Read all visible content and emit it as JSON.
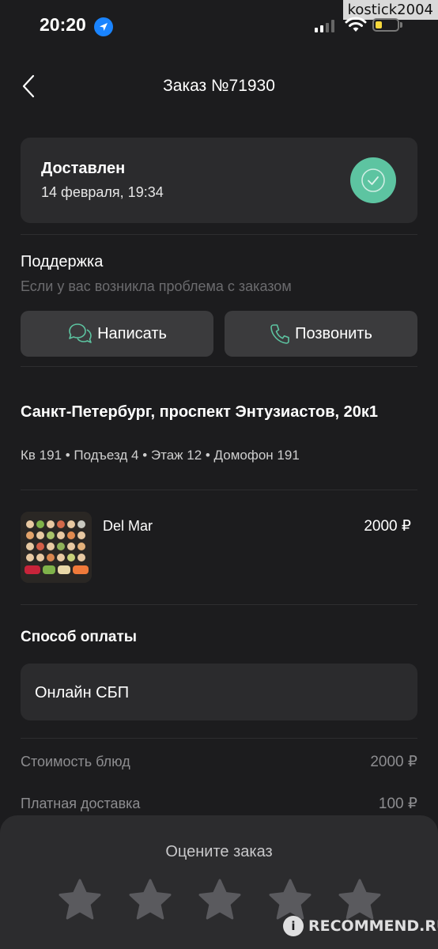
{
  "watermark_top": "kostick2004",
  "status_bar": {
    "time": "20:20"
  },
  "header": {
    "title": "Заказ №71930"
  },
  "order_status": {
    "title": "Доставлен",
    "date": "14 февраля, 19:34"
  },
  "support": {
    "title": "Поддержка",
    "subtitle": "Если у вас возникла проблема с заказом",
    "write_label": "Написать",
    "call_label": "Позвонить"
  },
  "address": {
    "line": "Санкт-Петербург, проспект Энтузиастов, 20к1",
    "details": "Кв 191 • Подъезд 4 • Этаж 12 • Домофон 191"
  },
  "items": [
    {
      "name": "Del Mar",
      "price": "2000 ₽"
    }
  ],
  "payment": {
    "title": "Способ оплаты",
    "method": "Онлайн СБП"
  },
  "summary": [
    {
      "label": "Стоимость блюд",
      "value": "2000 ₽"
    },
    {
      "label": "Платная доставка",
      "value": "100 ₽"
    }
  ],
  "rating": {
    "title": "Оцените заказ",
    "stars": 5,
    "selected": 0
  },
  "watermark_bottom": {
    "badge": "i",
    "text": "RECOMMEND.RU"
  },
  "colors": {
    "accent": "#5dc4a1",
    "background": "#1c1c1e",
    "card": "#2b2b2d",
    "button": "#3b3b3d"
  }
}
